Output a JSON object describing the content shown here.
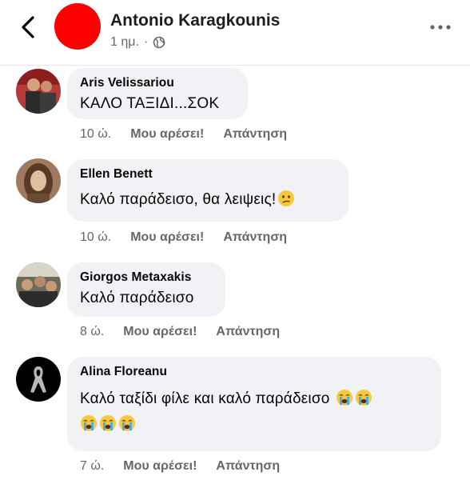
{
  "post_header": {
    "author": "Antonio Karagkounis",
    "time": "1 ημ.",
    "separator": "·"
  },
  "comments": [
    {
      "author": "Aris Velissariou",
      "text": "ΚΑΛΟ ΤΑΞΙΔΙ...ΣΟΚ",
      "time": "10 ώ.",
      "like_label": "Μου αρέσει!",
      "reply_label": "Απάντηση"
    },
    {
      "author": "Ellen Benett",
      "text": "Καλό παράδεισο, θα λειψεις!",
      "emoji": [
        "confused-face"
      ],
      "time": "10 ώ.",
      "like_label": "Μου αρέσει!",
      "reply_label": "Απάντηση"
    },
    {
      "author": "Giorgos Metaxakis",
      "text": "Καλό παράδεισο",
      "time": "8 ώ.",
      "like_label": "Μου αρέσει!",
      "reply_label": "Απάντηση"
    },
    {
      "author": "Alina Floreanu",
      "text_line1": "Καλό ταξίδι φίλε και καλό παράδεισο",
      "emoji": [
        "crying-face",
        "crying-face",
        "crying-face",
        "crying-face",
        "crying-face"
      ],
      "time": "7 ώ.",
      "like_label": "Μου αρέσει!",
      "reply_label": "Απάντηση"
    }
  ],
  "colors": {
    "bubble": "#f0f2f5",
    "meta_text": "#65676b",
    "header_avatar": "#ff0000"
  }
}
